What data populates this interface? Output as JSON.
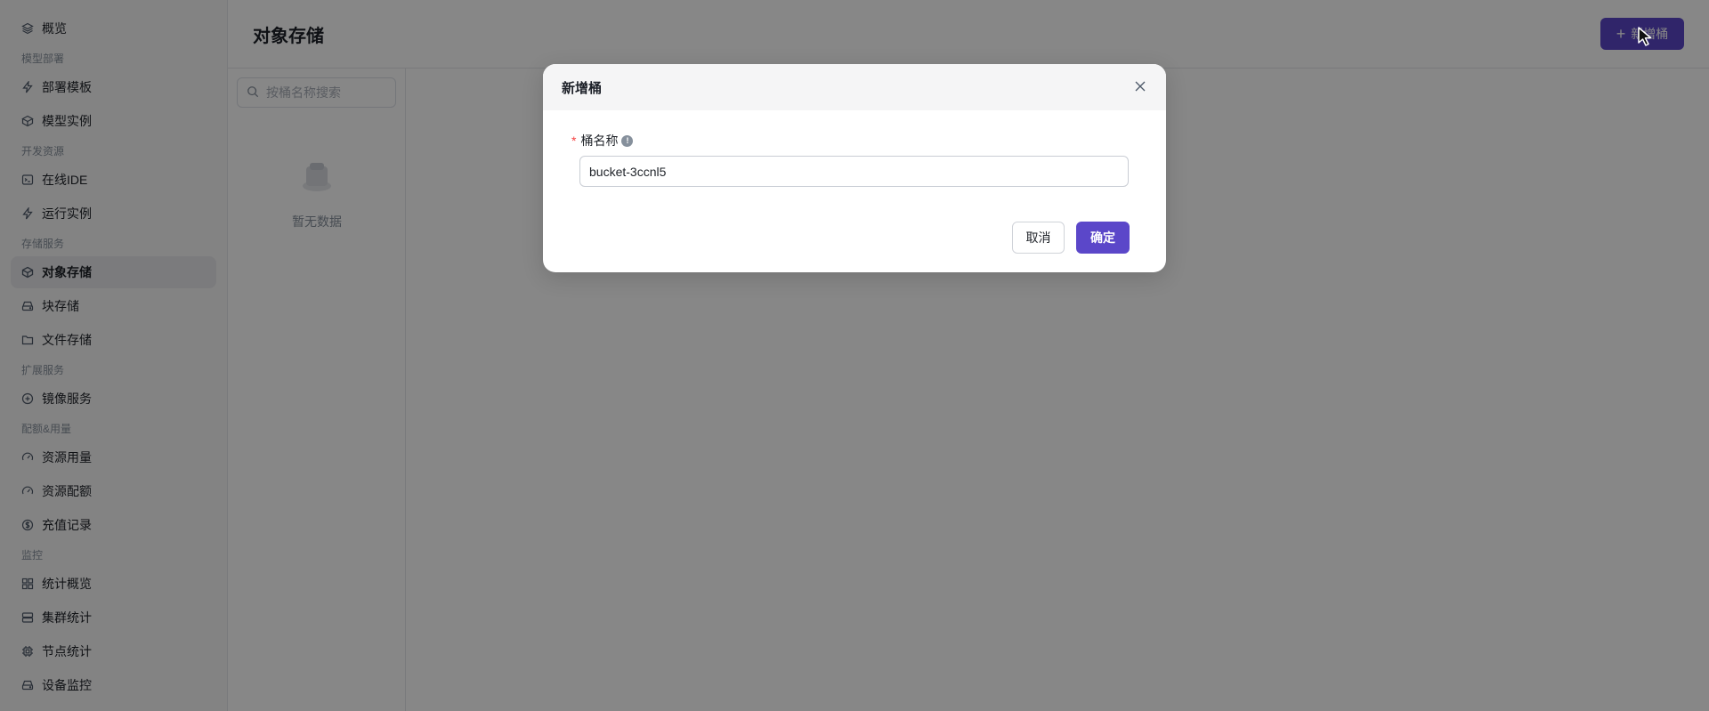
{
  "sidebar": {
    "items": [
      {
        "type": "item",
        "label": "概览",
        "icon": "layers-icon"
      },
      {
        "type": "group",
        "label": "模型部署"
      },
      {
        "type": "item",
        "label": "部署模板",
        "icon": "lightning-icon"
      },
      {
        "type": "item",
        "label": "模型实例",
        "icon": "cube-icon"
      },
      {
        "type": "group",
        "label": "开发资源"
      },
      {
        "type": "item",
        "label": "在线IDE",
        "icon": "terminal-icon"
      },
      {
        "type": "item",
        "label": "运行实例",
        "icon": "lightning-icon"
      },
      {
        "type": "group",
        "label": "存储服务"
      },
      {
        "type": "item",
        "label": "对象存储",
        "icon": "box-icon",
        "active": true
      },
      {
        "type": "item",
        "label": "块存储",
        "icon": "drive-icon"
      },
      {
        "type": "item",
        "label": "文件存储",
        "icon": "folder-icon"
      },
      {
        "type": "group",
        "label": "扩展服务"
      },
      {
        "type": "item",
        "label": "镜像服务",
        "icon": "plus-circle-icon"
      },
      {
        "type": "group",
        "label": "配额&用量"
      },
      {
        "type": "item",
        "label": "资源用量",
        "icon": "gauge-icon"
      },
      {
        "type": "item",
        "label": "资源配额",
        "icon": "gauge-icon"
      },
      {
        "type": "item",
        "label": "充值记录",
        "icon": "dollar-circle-icon"
      },
      {
        "type": "group",
        "label": "监控"
      },
      {
        "type": "item",
        "label": "统计概览",
        "icon": "grid-icon"
      },
      {
        "type": "item",
        "label": "集群统计",
        "icon": "server-icon"
      },
      {
        "type": "item",
        "label": "节点统计",
        "icon": "chip-icon"
      },
      {
        "type": "item",
        "label": "设备监控",
        "icon": "drive-icon"
      }
    ]
  },
  "header": {
    "title": "对象存储",
    "add_button_label": "新增桶"
  },
  "list_panel": {
    "search_placeholder": "按桶名称搜索",
    "empty_text": "暂无数据"
  },
  "modal": {
    "title": "新增桶",
    "field_label": "桶名称",
    "field_value": "bucket-3ccnl5",
    "cancel_label": "取消",
    "ok_label": "确定"
  },
  "colors": {
    "primary": "#5b47c9",
    "required": "#f53f3f",
    "overlay": "rgba(0,0,0,0.47)"
  }
}
